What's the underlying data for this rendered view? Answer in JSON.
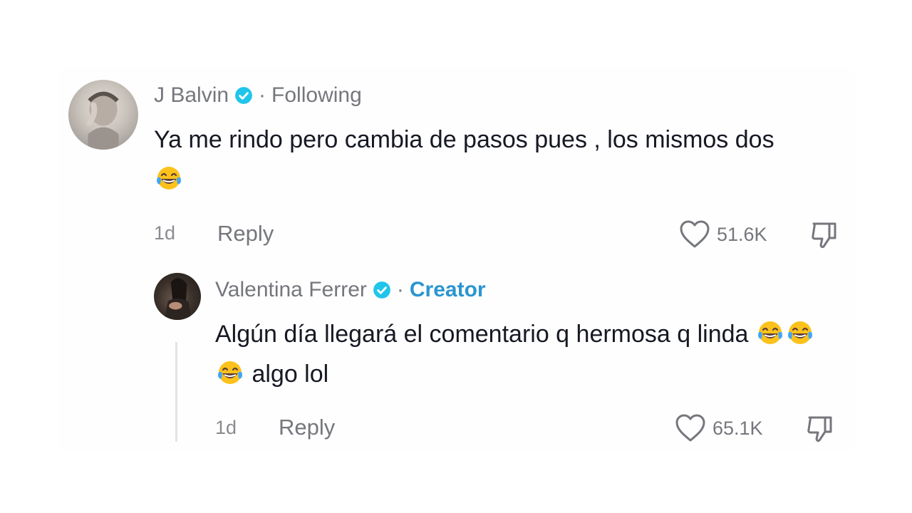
{
  "comments": [
    {
      "author": "J Balvin",
      "relation": "Following",
      "text": "Ya me rindo pero cambia de pasos pues , los mismos dos",
      "emoji_count": 1,
      "time": "1d",
      "reply_label": "Reply",
      "likes": "51.6K"
    },
    {
      "author": "Valentina Ferrer",
      "relation": "Creator",
      "text_before": "Algún día llegará el comentario q hermosa q linda",
      "emoji_count": 3,
      "text_after": "algo lol",
      "time": "1d",
      "reply_label": "Reply",
      "likes": "65.1K"
    }
  ],
  "icons": {
    "verified": "verified-badge-icon",
    "emoji": "face-with-tears-of-joy-icon",
    "like": "heart-outline-icon",
    "dislike": "thumbs-down-icon"
  },
  "colors": {
    "verified": "#20c5ea",
    "creator": "#2a95d0",
    "muted": "#75777c",
    "text": "#161823"
  }
}
